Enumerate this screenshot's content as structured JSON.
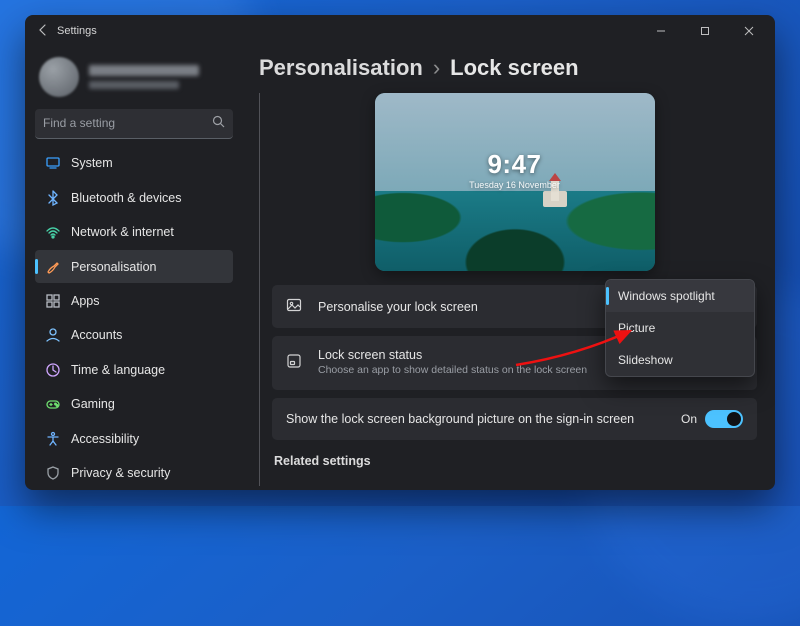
{
  "titlebar": {
    "title": "Settings"
  },
  "search": {
    "placeholder": "Find a setting"
  },
  "sidebar": {
    "items": [
      {
        "label": "System",
        "icon": "system",
        "color": "#3aa0ff"
      },
      {
        "label": "Bluetooth & devices",
        "icon": "bluetooth",
        "color": "#6fb4ff"
      },
      {
        "label": "Network & internet",
        "icon": "wifi",
        "color": "#47d0a7"
      },
      {
        "label": "Personalisation",
        "icon": "brush",
        "color": "#ff9b56",
        "active": true
      },
      {
        "label": "Apps",
        "icon": "apps",
        "color": "#b8bcc4"
      },
      {
        "label": "Accounts",
        "icon": "person",
        "color": "#7ec3ff"
      },
      {
        "label": "Time & language",
        "icon": "clock",
        "color": "#cfa6ff"
      },
      {
        "label": "Gaming",
        "icon": "gaming",
        "color": "#6fe06f"
      },
      {
        "label": "Accessibility",
        "icon": "accessibility",
        "color": "#6fb4ff"
      },
      {
        "label": "Privacy & security",
        "icon": "shield",
        "color": "#9aa0a6"
      }
    ]
  },
  "breadcrumb": {
    "parent": "Personalisation",
    "separator": "›",
    "leaf": "Lock screen"
  },
  "preview": {
    "time": "9:47",
    "date": "Tuesday 16 November"
  },
  "cards": {
    "personalise": {
      "title": "Personalise your lock screen"
    },
    "status": {
      "title": "Lock screen status",
      "subtitle": "Choose an app to show detailed status on the lock screen"
    },
    "signin": {
      "title": "Show the lock screen background picture on the sign-in screen",
      "value": "On"
    }
  },
  "dropdown": {
    "options": [
      {
        "label": "Windows spotlight",
        "selected": true
      },
      {
        "label": "Picture"
      },
      {
        "label": "Slideshow"
      }
    ]
  },
  "related_header": "Related settings"
}
